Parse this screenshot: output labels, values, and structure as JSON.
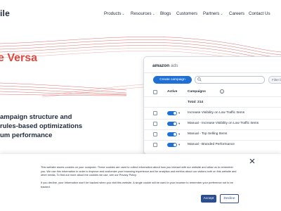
{
  "header": {
    "logo_text": "ile",
    "nav": [
      {
        "label": "Products",
        "dropdown": true
      },
      {
        "label": "Resources",
        "dropdown": true
      },
      {
        "label": "Blogs",
        "dropdown": false
      },
      {
        "label": "Customers",
        "dropdown": false
      },
      {
        "label": "Partners",
        "dropdown": true
      },
      {
        "label": "Careers",
        "dropdown": false
      },
      {
        "label": "Contact Us",
        "dropdown": false
      }
    ]
  },
  "hero": {
    "title": "e Versa",
    "description_lines": [
      "ampaign structure and",
      "rules-based optimizations",
      "um performance"
    ],
    "accent_color": "#e0483f"
  },
  "amazon_panel": {
    "logo_prefix": "amazon",
    "logo_suffix": "ads",
    "create_button": "Create campaign",
    "filter_button": "Filter by",
    "columns": {
      "active": "Active",
      "campaigns": "Campaigns"
    },
    "total_label": "Total: 214",
    "rows": [
      {
        "name": "Increase Visibility on Low Traffic Items",
        "active": true
      },
      {
        "name": "Manual - Increase Visibility on Low Traffic Items",
        "active": true
      },
      {
        "name": "Manual - Top Selling Items",
        "active": true
      },
      {
        "name": "Manual - Branded Performance",
        "active": true
      }
    ],
    "accent_color": "#1f6fd4"
  },
  "cookie_banner": {
    "text_main": "This website stores cookies on your computer. These cookies are used to collect information about how you interact with our website and allow us to remember you. We use this information in order to improve and customize your browsing experience and for analytics and metrics about our visitors both on this website and other media. To find out more about the cookies we use, see our Privacy Policy.",
    "text_decline": "If you decline, your information won't be tracked when you visit this website. A single cookie will be used in your browser to remember your preference not to be tracked.",
    "accept_label": "Accept",
    "decline_label": "Decline",
    "button_color": "#2d4e8e"
  }
}
